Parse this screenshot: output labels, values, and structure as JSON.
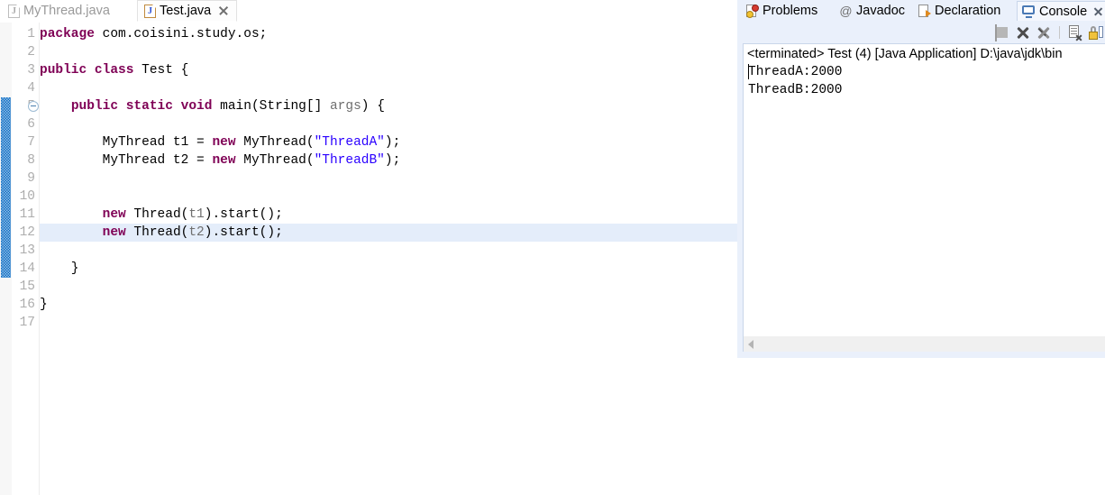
{
  "editor": {
    "tabs": [
      {
        "label": "MyThread.java",
        "icon": "java-file-icon",
        "active": false,
        "closable": false
      },
      {
        "label": "Test.java",
        "icon": "java-file-icon",
        "active": true,
        "closable": true
      }
    ],
    "current_line": 12,
    "change_bar_lines": [
      5,
      14
    ],
    "fold_marker_line": 5,
    "line_numbers": [
      "1",
      "2",
      "3",
      "4",
      "5",
      "6",
      "7",
      "8",
      "9",
      "10",
      "11",
      "12",
      "13",
      "14",
      "15",
      "16",
      "17"
    ],
    "code_lines": [
      {
        "n": 1,
        "tokens": [
          {
            "t": "package",
            "c": "kw"
          },
          {
            "t": " com.coisini.study.os;",
            "c": "pln"
          }
        ]
      },
      {
        "n": 2,
        "tokens": []
      },
      {
        "n": 3,
        "tokens": [
          {
            "t": "public class",
            "c": "kw"
          },
          {
            "t": " Test {",
            "c": "pln"
          }
        ]
      },
      {
        "n": 4,
        "tokens": []
      },
      {
        "n": 5,
        "tokens": [
          {
            "t": "    ",
            "c": "pln"
          },
          {
            "t": "public static void",
            "c": "kw"
          },
          {
            "t": " main(String[] ",
            "c": "pln"
          },
          {
            "t": "args",
            "c": "prm"
          },
          {
            "t": ") {",
            "c": "pln"
          }
        ]
      },
      {
        "n": 6,
        "tokens": []
      },
      {
        "n": 7,
        "tokens": [
          {
            "t": "        MyThread t1 = ",
            "c": "pln"
          },
          {
            "t": "new",
            "c": "kw"
          },
          {
            "t": " MyThread(",
            "c": "pln"
          },
          {
            "t": "\"ThreadA\"",
            "c": "str"
          },
          {
            "t": ");",
            "c": "pln"
          }
        ]
      },
      {
        "n": 8,
        "tokens": [
          {
            "t": "        MyThread t2 = ",
            "c": "pln"
          },
          {
            "t": "new",
            "c": "kw"
          },
          {
            "t": " MyThread(",
            "c": "pln"
          },
          {
            "t": "\"ThreadB\"",
            "c": "str"
          },
          {
            "t": ");",
            "c": "pln"
          }
        ]
      },
      {
        "n": 9,
        "tokens": []
      },
      {
        "n": 10,
        "tokens": []
      },
      {
        "n": 11,
        "tokens": [
          {
            "t": "        ",
            "c": "pln"
          },
          {
            "t": "new",
            "c": "kw"
          },
          {
            "t": " Thread(",
            "c": "pln"
          },
          {
            "t": "t1",
            "c": "prm"
          },
          {
            "t": ").start();",
            "c": "pln"
          }
        ]
      },
      {
        "n": 12,
        "tokens": [
          {
            "t": "        ",
            "c": "pln"
          },
          {
            "t": "new",
            "c": "kw"
          },
          {
            "t": " Thread(",
            "c": "pln"
          },
          {
            "t": "t2",
            "c": "prm"
          },
          {
            "t": ").start();",
            "c": "pln"
          }
        ]
      },
      {
        "n": 13,
        "tokens": []
      },
      {
        "n": 14,
        "tokens": [
          {
            "t": "    }",
            "c": "pln"
          }
        ]
      },
      {
        "n": 15,
        "tokens": []
      },
      {
        "n": 16,
        "tokens": [
          {
            "t": "}",
            "c": "pln"
          }
        ]
      },
      {
        "n": 17,
        "tokens": []
      }
    ]
  },
  "console_panel": {
    "tabs": [
      {
        "label": "Problems",
        "icon": "problems-icon",
        "active": false,
        "closable": false
      },
      {
        "label": "Javadoc",
        "icon": "javadoc-icon",
        "active": false,
        "closable": false
      },
      {
        "label": "Declaration",
        "icon": "declaration-icon",
        "active": false,
        "closable": false
      },
      {
        "label": "Console",
        "icon": "console-icon",
        "active": true,
        "closable": true
      }
    ],
    "toolbar": [
      {
        "name": "terminate-button",
        "title": "Terminate"
      },
      {
        "name": "remove-launch-button",
        "title": "Remove Launch"
      },
      {
        "name": "remove-all-launches-button",
        "title": "Remove All Terminated Launches"
      },
      {
        "name": "clear-console-button",
        "title": "Clear Console"
      },
      {
        "name": "scroll-lock-button",
        "title": "Scroll Lock"
      }
    ],
    "header_line": "<terminated> Test (4) [Java Application] D:\\java\\jdk\\bin",
    "output_lines": [
      "ThreadA:2000",
      "ThreadB:2000"
    ]
  },
  "colors": {
    "keyword": "#7f0055",
    "string": "#2a00ff",
    "line_number": "#adadad",
    "current_line_highlight": "#e4edfa",
    "change_bar": "#0f6fc5",
    "panel_background": "#eaf0fb"
  }
}
